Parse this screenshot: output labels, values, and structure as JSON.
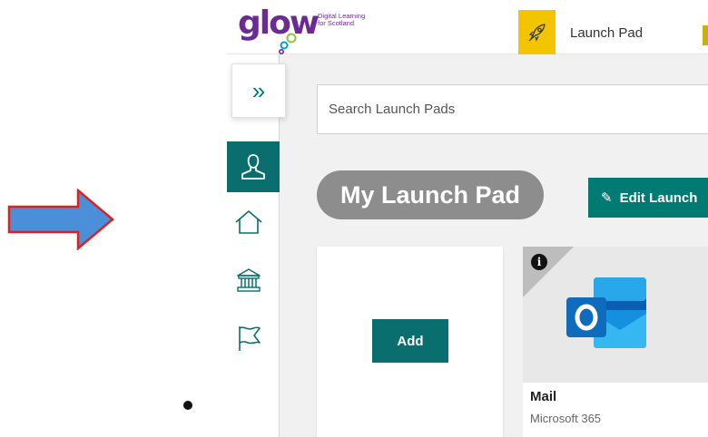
{
  "logo": {
    "wordmark": "glow",
    "tagline_line1": "Digital Learning",
    "tagline_line2": "for Scotland",
    "color": "#6b2c91"
  },
  "topbar": {
    "active_tab_label": "Launch Pad",
    "active_tab_icon": "rocket-icon",
    "active_tab_color": "#f2c500"
  },
  "sidebar": {
    "expand_icon": "double-chevron-right-icon",
    "items": [
      {
        "icon": "user-icon",
        "active": true
      },
      {
        "icon": "home-icon",
        "active": false
      },
      {
        "icon": "institution-icon",
        "active": false
      },
      {
        "icon": "flag-icon",
        "active": false
      }
    ],
    "accent": "#0b6e6e"
  },
  "main": {
    "search_placeholder": "Search Launch Pads",
    "heading": "My Launch Pad",
    "edit_button_label": "Edit Launch",
    "add_button_label": "Add",
    "tiles": [
      {
        "title": "Mail",
        "subtitle": "Microsoft 365",
        "icon": "outlook-icon",
        "info_icon": "info-icon"
      }
    ]
  },
  "annotation": {
    "arrow_icon": "arrow-right-icon",
    "arrow_fill": "#4a8fd8",
    "arrow_stroke": "#e02020"
  }
}
